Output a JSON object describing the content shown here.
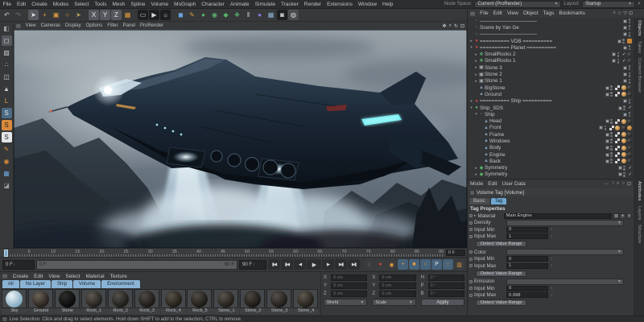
{
  "menubar": {
    "items": [
      "File",
      "Edit",
      "Create",
      "Modes",
      "Select",
      "Tools",
      "Mesh",
      "Spline",
      "Volume",
      "MoGraph",
      "Character",
      "Animate",
      "Simulate",
      "Tracker",
      "Render",
      "Extensions",
      "Window",
      "Help"
    ],
    "node_space_label": "Node Space:",
    "node_space_value": "Current (ProRender)",
    "layout_label": "Layout:",
    "layout_value": "Startup"
  },
  "toolbar": {
    "icons": [
      {
        "name": "undo-icon",
        "glyph": "↶",
        "fg": "#c8cbcd",
        "bg": "transparent"
      },
      {
        "name": "redo-icon",
        "glyph": "↷",
        "fg": "#6f7274",
        "bg": "transparent"
      },
      {
        "name": "live-selection-icon",
        "glyph": "➤",
        "fg": "#e8ebed",
        "bg": "#55585c"
      },
      {
        "name": "move-icon",
        "glyph": "+",
        "fg": "#e09a3c",
        "bg": "transparent"
      },
      {
        "name": "scale-icon",
        "glyph": "▣",
        "fg": "#e09a3c",
        "bg": "transparent"
      },
      {
        "name": "rotate-icon",
        "glyph": "○",
        "fg": "#e09a3c",
        "bg": "transparent"
      },
      {
        "name": "last-tool-icon",
        "glyph": "➤",
        "fg": "#b9a15c",
        "bg": "transparent"
      },
      {
        "name": "x-axis-lock-icon",
        "glyph": "X",
        "fg": "#e3e6e8",
        "bg": "#55585c"
      },
      {
        "name": "y-axis-lock-icon",
        "glyph": "Y",
        "fg": "#e3e6e8",
        "bg": "#55585c"
      },
      {
        "name": "z-axis-lock-icon",
        "glyph": "Z",
        "fg": "#e3e6e8",
        "bg": "#55585c"
      },
      {
        "name": "coord-system-icon",
        "glyph": "▦",
        "fg": "#e09a3c",
        "bg": "transparent"
      },
      {
        "name": "render-view-icon",
        "glyph": "▭",
        "fg": "#d8dbdd",
        "bg": "#1d1f21"
      },
      {
        "name": "render-picture-viewer-icon",
        "glyph": "▶",
        "fg": "#d8dbdd",
        "bg": "#1d1f21"
      },
      {
        "name": "render-settings-icon",
        "glyph": "☼",
        "fg": "#d8dbdd",
        "bg": "#1d1f21"
      },
      {
        "name": "add-cube-icon",
        "glyph": "◼",
        "fg": "#6aa0d8",
        "bg": "transparent"
      },
      {
        "name": "pen-spline-icon",
        "glyph": "✎",
        "fg": "#e09a3c",
        "bg": "transparent"
      },
      {
        "name": "subdivision-surface-icon",
        "glyph": "●",
        "fg": "#59b26a",
        "bg": "transparent"
      },
      {
        "name": "generator-icon",
        "glyph": "◉",
        "fg": "#59b26a",
        "bg": "transparent"
      },
      {
        "name": "deformer-icon",
        "glyph": "◆",
        "fg": "#59b26a",
        "bg": "transparent"
      },
      {
        "name": "mograph-clone-icon",
        "glyph": "❖",
        "fg": "#59b26a",
        "bg": "transparent"
      },
      {
        "name": "rig-icon",
        "glyph": "‖",
        "fg": "#d8dbdd",
        "bg": "transparent"
      },
      {
        "name": "volume-builder-icon",
        "glyph": "●",
        "fg": "#8a7ae0",
        "bg": "transparent"
      },
      {
        "name": "floor-icon",
        "glyph": "▦",
        "fg": "#8fb3d8",
        "bg": "transparent"
      },
      {
        "name": "camera-icon",
        "glyph": "◙",
        "fg": "#d8dbdd",
        "bg": "#1d1f21"
      },
      {
        "name": "light-icon",
        "glyph": "◍",
        "fg": "#d8dbdd",
        "bg": "#4a4d50"
      }
    ]
  },
  "left_toolbar": {
    "icons": [
      {
        "name": "make-editable-icon",
        "glyph": "◧",
        "fg": "#9a9da0",
        "bg": "transparent"
      },
      {
        "name": "model-mode-icon",
        "glyph": "◻",
        "fg": "#dfe2e4",
        "bg": "#55585c"
      },
      {
        "name": "texture-mode-icon",
        "glyph": "▨",
        "fg": "#c8cbcd",
        "bg": "transparent"
      },
      {
        "name": "point-mode-icon",
        "glyph": "∴",
        "fg": "#c8cbcd",
        "bg": "transparent"
      },
      {
        "name": "edge-mode-icon",
        "glyph": "◫",
        "fg": "#c8cbcd",
        "bg": "transparent"
      },
      {
        "name": "polygon-mode-icon",
        "glyph": "▲",
        "fg": "#c8cbcd",
        "bg": "transparent"
      },
      {
        "name": "axis-mode-icon",
        "glyph": "L",
        "fg": "#e09a3c",
        "bg": "transparent"
      },
      {
        "name": "snap-enable-icon",
        "glyph": "S",
        "fg": "#e3e6e8",
        "bg": "#4c6a84"
      },
      {
        "name": "snap-quantize-icon",
        "glyph": "S",
        "fg": "#1d1f21",
        "bg": "#d98a3d"
      },
      {
        "name": "snap-workplane-icon",
        "glyph": "S",
        "fg": "#1d1f21",
        "bg": "#e3e6e8"
      },
      {
        "name": "brush-icon",
        "glyph": "✎",
        "fg": "#d98a3d",
        "bg": "transparent"
      },
      {
        "name": "solo-icon",
        "glyph": "◉",
        "fg": "#d98a3d",
        "bg": "transparent"
      },
      {
        "name": "workplane-icon",
        "glyph": "▦",
        "fg": "#6aa0d8",
        "bg": "transparent"
      },
      {
        "name": "lock-workplane-icon",
        "glyph": "◪",
        "fg": "#9a9da0",
        "bg": "transparent"
      }
    ]
  },
  "viewport": {
    "menus": [
      "View",
      "Cameras",
      "Display",
      "Options",
      "Filter",
      "Panel",
      "ProRender"
    ],
    "nav_icons": [
      {
        "name": "viewport-pan-icon",
        "glyph": "✥"
      },
      {
        "name": "viewport-zoom-icon",
        "glyph": "⌕"
      },
      {
        "name": "viewport-rotate-icon",
        "glyph": "↻"
      },
      {
        "name": "viewport-toggle-icon",
        "glyph": "⊡"
      }
    ]
  },
  "objects_panel": {
    "menus": [
      "File",
      "Edit",
      "View",
      "Object",
      "Tags",
      "Bookmarks"
    ],
    "header_icons": [
      {
        "name": "search-icon",
        "glyph": "⌕"
      },
      {
        "name": "bookmark-star-icon",
        "glyph": "☆"
      },
      {
        "name": "filter-funnel-icon",
        "glyph": "▽"
      },
      {
        "name": "panel-box-icon",
        "glyph": "⊡"
      }
    ],
    "side_tabs": [
      {
        "label": "Objects",
        "active": true
      },
      {
        "label": "Takes",
        "active": false
      },
      {
        "label": "Content Browser",
        "active": false
      }
    ],
    "tree": [
      {
        "label": "────────────────",
        "icon": "null",
        "depth": 0,
        "expander": "",
        "tags": []
      },
      {
        "label": "Scene by Yan Ge",
        "icon": "null",
        "depth": 0,
        "expander": "",
        "tags": []
      },
      {
        "label": "────────────────",
        "icon": "null",
        "depth": 0,
        "expander": "",
        "tags": []
      },
      {
        "label": "========== VDB ==========",
        "icon": "warn",
        "depth": 0,
        "expander": "▸",
        "tags": [
          "orange"
        ]
      },
      {
        "label": "========== Planet ==========",
        "icon": "warn",
        "depth": 0,
        "expander": "▾",
        "tags": []
      },
      {
        "label": "SmallRocks 2",
        "icon": "cloner",
        "depth": 1,
        "expander": "▸",
        "tags": [
          "check",
          "mat"
        ]
      },
      {
        "label": "SmallRocks 1",
        "icon": "cloner",
        "depth": 1,
        "expander": "▸",
        "tags": [
          "check",
          "mat"
        ]
      },
      {
        "label": "Stone 3",
        "icon": "nullbox",
        "depth": 1,
        "expander": "▸",
        "tags": []
      },
      {
        "label": "Stone 2",
        "icon": "nullbox",
        "depth": 1,
        "expander": "▸",
        "tags": []
      },
      {
        "label": "Stone 1",
        "icon": "nullbox",
        "depth": 1,
        "expander": "▸",
        "tags": []
      },
      {
        "label": "BigStone",
        "icon": "poly",
        "depth": 1,
        "expander": "",
        "tags": [
          "uvw",
          "phong",
          "mat"
        ]
      },
      {
        "label": "Ground",
        "icon": "poly",
        "depth": 1,
        "expander": "",
        "tags": [
          "uvw",
          "phong",
          "mat"
        ]
      },
      {
        "label": "========== Ship ==========",
        "icon": "warn",
        "depth": 0,
        "expander": "▾",
        "tags": []
      },
      {
        "label": "Ship_SDS",
        "icon": "sds",
        "depth": 0,
        "expander": "▾",
        "tags": [
          "check"
        ]
      },
      {
        "label": "Ship",
        "icon": "null",
        "depth": 1,
        "expander": "▾",
        "tags": []
      },
      {
        "label": "Head",
        "icon": "poly",
        "depth": 2,
        "expander": "",
        "tags": [
          "uvw",
          "phong",
          "mat"
        ]
      },
      {
        "label": "Front",
        "icon": "poly",
        "depth": 2,
        "expander": "",
        "tags": [
          "uvw",
          "phong",
          "mat",
          "glow"
        ]
      },
      {
        "label": "Frame",
        "icon": "poly",
        "depth": 2,
        "expander": "",
        "tags": [
          "uvw",
          "phong",
          "mat"
        ]
      },
      {
        "label": "Windows",
        "icon": "poly",
        "depth": 2,
        "expander": "",
        "tags": [
          "uvw",
          "phong",
          "mat"
        ]
      },
      {
        "label": "Body",
        "icon": "poly",
        "depth": 2,
        "expander": "",
        "tags": [
          "uvw",
          "phong",
          "mat"
        ]
      },
      {
        "label": "Engine",
        "icon": "poly",
        "depth": 2,
        "expander": "",
        "tags": [
          "uvw",
          "phong",
          "mat"
        ]
      },
      {
        "label": "Back",
        "icon": "poly",
        "depth": 2,
        "expander": "",
        "tags": [
          "uvw",
          "phong",
          "mat"
        ]
      },
      {
        "label": "Symmetry",
        "icon": "sym",
        "depth": 1,
        "expander": "▸",
        "tags": [
          "check"
        ]
      },
      {
        "label": "Symmetry",
        "icon": "sym",
        "depth": 1,
        "expander": "▸",
        "tags": [
          "check"
        ]
      }
    ]
  },
  "attributes_panel": {
    "menus": [
      "Mode",
      "Edit",
      "User Data"
    ],
    "header_icons": [
      {
        "name": "back-arrow-icon",
        "glyph": "←"
      },
      {
        "name": "up-arrow-icon",
        "glyph": "↑"
      },
      {
        "name": "search-icon",
        "glyph": "⌕"
      },
      {
        "name": "history-icon",
        "glyph": "○"
      },
      {
        "name": "panel-box-icon",
        "glyph": "⊡"
      }
    ],
    "title": "Volume Tag [Volume]",
    "tabs": [
      {
        "label": "Basic",
        "active": false
      },
      {
        "label": "Tag",
        "active": true
      }
    ],
    "section": "Tag Properties",
    "material_label": "Material",
    "material_value": "Main Engine",
    "groups": [
      {
        "channel": "Density",
        "min_label": "Input Min",
        "min": "0",
        "max_label": "Input Max",
        "max": "1",
        "button": "Detect Value Range"
      },
      {
        "channel": "Color",
        "min_label": "Input Min",
        "min": "0",
        "max_label": "Input Max",
        "max": "1",
        "button": "Detect Value Range"
      },
      {
        "channel": "Emission",
        "min_label": "Input Min",
        "min": "0",
        "max_label": "Input Max",
        "max": "0.998",
        "button": "Detect Value Range"
      }
    ],
    "side_tabs": [
      {
        "label": "Attributes",
        "active": true
      },
      {
        "label": "Layers",
        "active": false
      },
      {
        "label": "Structure",
        "active": false
      }
    ]
  },
  "timeline": {
    "tick_labels": [
      "5",
      "10",
      "15",
      "20",
      "25",
      "30",
      "35",
      "40",
      "45",
      "50",
      "55",
      "60",
      "65",
      "70",
      "75",
      "80",
      "85",
      "90"
    ],
    "ruler_frame": "0 F",
    "current_frame": "0 F",
    "range_start": "0 F",
    "range_end": "90 F",
    "end_frame": "90 F",
    "transport": [
      {
        "name": "goto-start-button",
        "glyph": "▮◀"
      },
      {
        "name": "prev-key-button",
        "glyph": "▮◀"
      },
      {
        "name": "prev-frame-button",
        "glyph": "◀"
      },
      {
        "name": "play-button",
        "glyph": "▶"
      },
      {
        "name": "next-frame-button",
        "glyph": "▶"
      },
      {
        "name": "next-key-button",
        "glyph": "▶▮"
      },
      {
        "name": "goto-end-button",
        "glyph": "▶▮"
      }
    ],
    "key_icons": [
      {
        "name": "sound-icon",
        "glyph": "♪",
        "fg": "#6f7274",
        "bg": "#3a3c3e"
      },
      {
        "name": "record-icon",
        "glyph": "●",
        "fg": "#c2453f",
        "bg": "#3a3c3e"
      },
      {
        "name": "autokey-icon",
        "glyph": "◉",
        "fg": "#e09a3c",
        "bg": "#3a3c3e"
      },
      {
        "name": "key-position-icon",
        "glyph": "+",
        "fg": "#e09a3c",
        "bg": "#46627a"
      },
      {
        "name": "key-scale-icon",
        "glyph": "■",
        "fg": "#e09a3c",
        "bg": "#46627a"
      },
      {
        "name": "key-rotation-icon",
        "glyph": "○",
        "fg": "#e09a3c",
        "bg": "#46627a"
      },
      {
        "name": "key-parameter-icon",
        "glyph": "P",
        "fg": "#e3e6e8",
        "bg": "#46627a"
      },
      {
        "name": "key-pla-icon",
        "glyph": "∷",
        "fg": "#e09a3c",
        "bg": "#46627a"
      },
      {
        "name": "keyframe-selection-icon",
        "glyph": "▥",
        "fg": "#e09a3c",
        "bg": "#3a3c3e"
      }
    ]
  },
  "materials_panel": {
    "menus": [
      "Create",
      "Edit",
      "View",
      "Select",
      "Material",
      "Texture"
    ],
    "layer_tabs": [
      "All",
      "No Layer",
      "Ship",
      "Volume",
      "Environment"
    ],
    "materials": [
      {
        "name": "Sky",
        "c1": "#eef3f5",
        "c2": "#7fa8c0"
      },
      {
        "name": "Ground",
        "c1": "#6a6358",
        "c2": "#211d19"
      },
      {
        "name": "Stone",
        "c1": "#2e2d2c",
        "c2": "#080808"
      },
      {
        "name": "Rock_1",
        "c1": "#5e5a52",
        "c2": "#1e1c18"
      },
      {
        "name": "Rock_2",
        "c1": "#55514b",
        "c2": "#1b1916"
      },
      {
        "name": "Rock_3",
        "c1": "#4e4a44",
        "c2": "#181613"
      },
      {
        "name": "Rock_4",
        "c1": "#585349",
        "c2": "#1d1a15"
      },
      {
        "name": "Rock_5",
        "c1": "#514d47",
        "c2": "#191713"
      },
      {
        "name": "Stone_1",
        "c1": "#5a564e",
        "c2": "#1c1a16"
      },
      {
        "name": "Stone_2",
        "c1": "#4c4841",
        "c2": "#161412"
      },
      {
        "name": "Stone_3",
        "c1": "#55504a",
        "c2": "#1a1815"
      },
      {
        "name": "Stone_4",
        "c1": "#5e594f",
        "c2": "#1e1b16"
      }
    ]
  },
  "coordinates_panel": {
    "position": {
      "x_label": "X",
      "x": "0 cm",
      "y_label": "Y",
      "y": "0 cm",
      "z_label": "Z",
      "z": "0 cm",
      "dropdown": "World"
    },
    "size": {
      "x_label": "X",
      "x": "0 cm",
      "y_label": "Y",
      "y": "0 cm",
      "z_label": "Z",
      "z": "0 cm",
      "dropdown": "Scale"
    },
    "rotation": {
      "h_label": "H",
      "h": "0 °",
      "p_label": "P",
      "p": "0 °",
      "b_label": "B",
      "b": "0 °",
      "apply": "Apply"
    }
  },
  "statusbar": {
    "text": "Live Selection: Click and drag to select elements. Hold down SHIFT to add to the selection, CTRL to remove."
  }
}
